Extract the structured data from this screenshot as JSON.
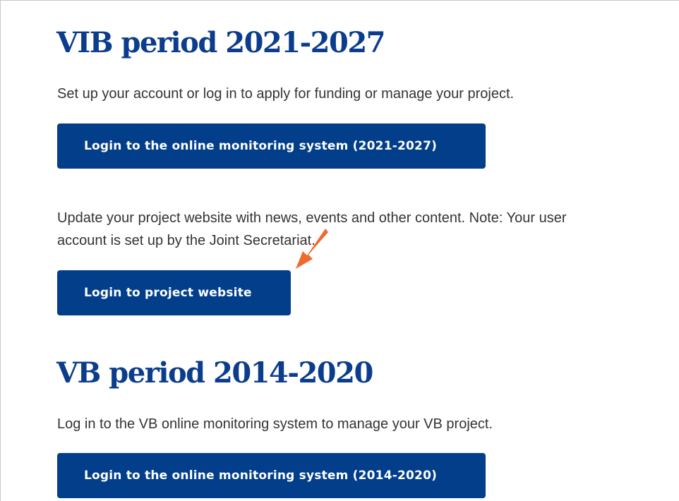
{
  "section_2021": {
    "title": "VIB period 2021-2027",
    "intro": "Set up your account or log in to apply for funding or manage your project.",
    "monitoring_button": "Login to the online monitoring system (2021-2027)",
    "website_text_line1": "Update your project website with news, events and other content. Note: Your user",
    "website_text_line2": "account is set up by the Joint Secretariat.",
    "website_button": "Login to project website"
  },
  "section_2014": {
    "title": "VB period 2014-2020",
    "intro": "Log in to the VB online monitoring system to manage your VB project.",
    "monitoring_button": "Login to the online monitoring system (2014-2020)"
  },
  "annotation": {
    "arrow_icon": "arrow-pointer-icon",
    "arrow_color": "#ee6a2f"
  },
  "colors": {
    "heading": "#0b3d8c",
    "button": "#023e8a",
    "text": "#333333"
  }
}
